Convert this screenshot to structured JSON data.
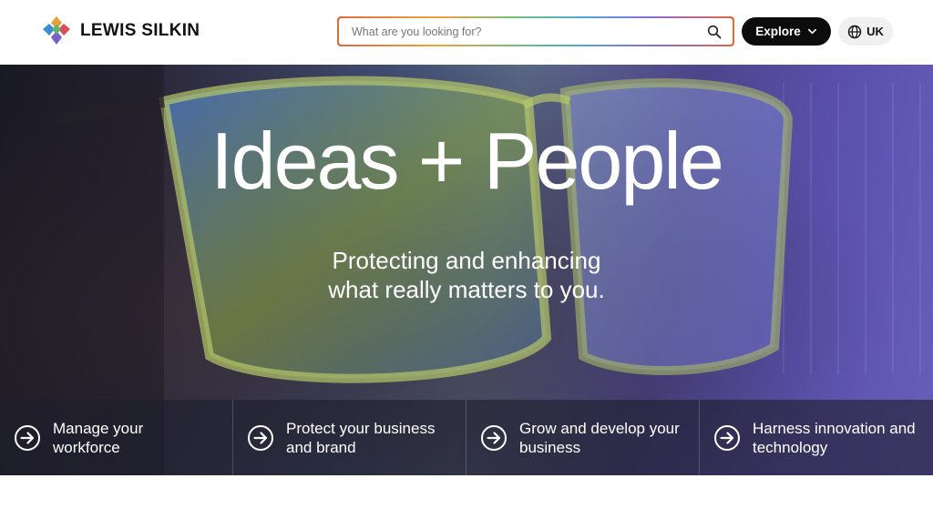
{
  "header": {
    "logo_text": "LEWIS SILKIN",
    "search": {
      "placeholder": "What are you looking for?",
      "value": ""
    },
    "explore_label": "Explore",
    "region_label": "UK"
  },
  "hero": {
    "title": "Ideas + People",
    "subtitle_line1": "Protecting and enhancing",
    "subtitle_line2": "what really matters to you."
  },
  "cards": [
    {
      "label": "Manage your\nworkforce",
      "icon": "arrow-circle-icon"
    },
    {
      "label": "Protect your business\nand brand",
      "icon": "arrow-circle-icon"
    },
    {
      "label": "Grow and develop your\nbusiness",
      "icon": "arrow-circle-icon"
    },
    {
      "label": "Harness innovation and\ntechnology",
      "icon": "arrow-circle-icon"
    }
  ],
  "colors": {
    "button_dark": "#0c0c0c",
    "region_bg": "#f0f0f0",
    "card_overlay": "rgba(30,30,45,0.62)"
  }
}
